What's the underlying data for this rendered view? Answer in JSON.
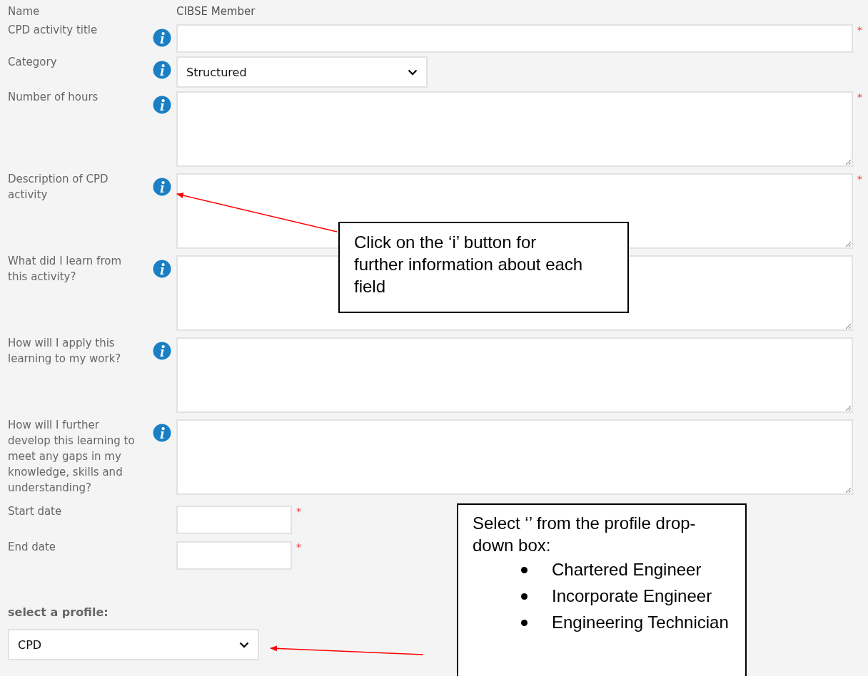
{
  "name_row": {
    "label": "Name",
    "value": "CIBSE Member"
  },
  "fields": [
    {
      "label": "CPD activity title",
      "kind": "input",
      "info": true,
      "required_mark": "*"
    },
    {
      "label": "Category",
      "kind": "select",
      "value": "Structured",
      "info": true
    },
    {
      "label": "Number of hours",
      "kind": "textarea",
      "info": true,
      "required_mark": "*"
    },
    {
      "label": "Description of CPD activity",
      "kind": "textarea",
      "info": true,
      "required_mark": "*"
    },
    {
      "label": "What did I learn from this activity?",
      "kind": "textarea",
      "info": true
    },
    {
      "label": "How will I apply this learning to my work?",
      "kind": "textarea",
      "info": true
    },
    {
      "label": "How will I further develop this learning to meet any gaps in my knowledge, skills and understanding?",
      "kind": "textarea",
      "info": true
    },
    {
      "label": "Start date",
      "kind": "date",
      "info": false,
      "required_mark": "*"
    },
    {
      "label": "End date",
      "kind": "date",
      "info": false,
      "required_mark": "*"
    }
  ],
  "profile": {
    "label": "select a profile:",
    "value": "CPD"
  },
  "callouts": [
    {
      "text": "Click on the ‘i’ button for further information about each field"
    },
    {
      "text": "Select ‘’ from the profile drop-down box:",
      "items": [
        "Chartered Engineer",
        "Incorporate Engineer",
        "Engineering Technician"
      ]
    }
  ]
}
